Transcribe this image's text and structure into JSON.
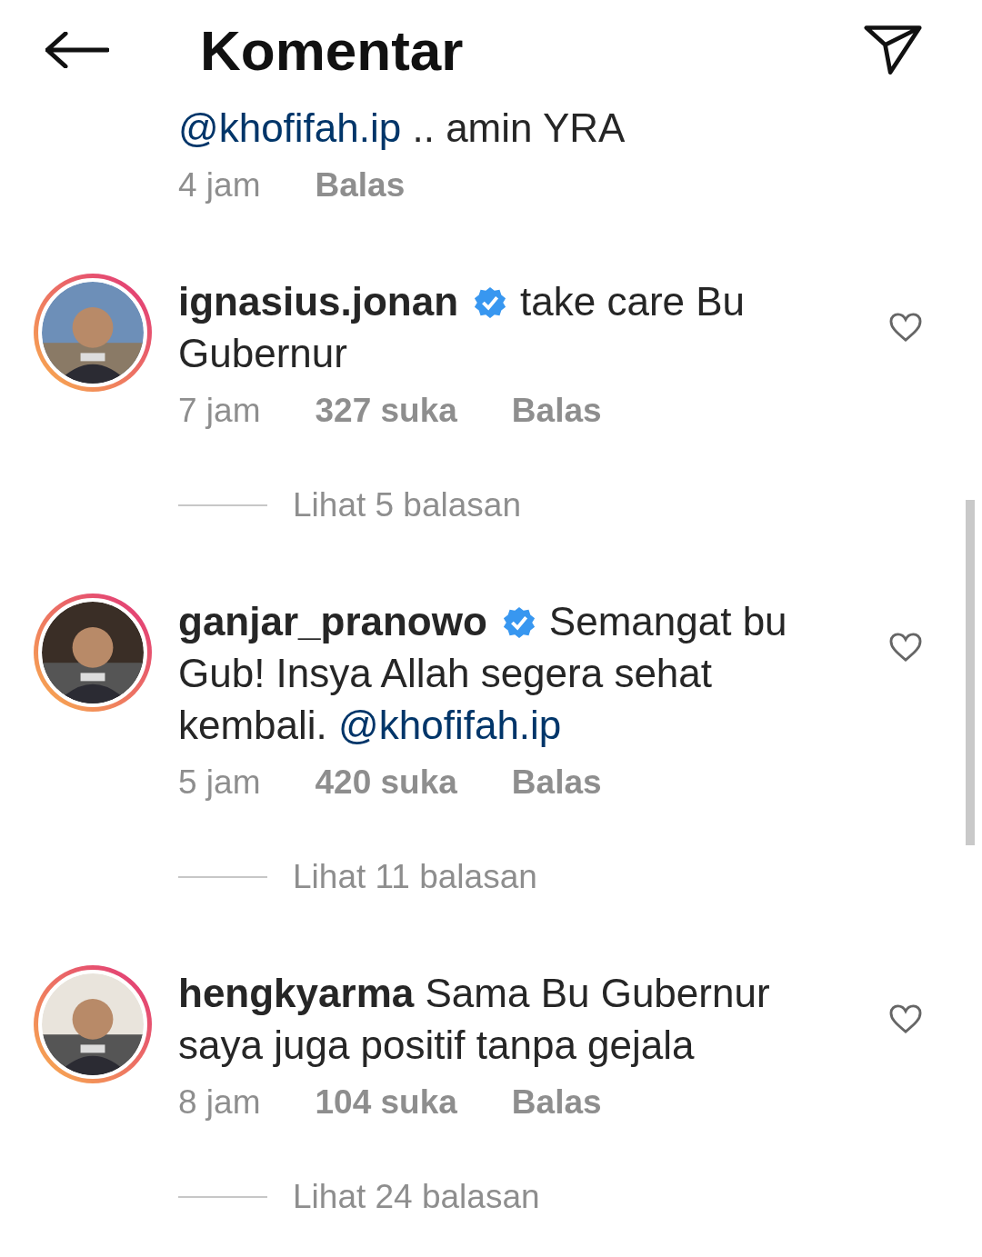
{
  "header": {
    "title": "Komentar"
  },
  "top_comment": {
    "mention": "@khofifah.ip",
    "text": ".. amin YRA",
    "time": "4 jam",
    "reply": "Balas"
  },
  "comments": [
    {
      "username": "ignasius.jonan",
      "verified": true,
      "text": "take care Bu Gubernur",
      "time": "7 jam",
      "likes": "327 suka",
      "reply": "Balas",
      "liked": false,
      "replies": "Lihat 5 balasan"
    },
    {
      "username": "ganjar_pranowo",
      "verified": true,
      "text": "Semangat bu Gub! Insya Allah segera sehat kembali.",
      "mention": "@khofifah.ip",
      "time": "5 jam",
      "likes": "420 suka",
      "reply": "Balas",
      "liked": false,
      "replies": "Lihat 11 balasan"
    },
    {
      "username": "hengkyarma",
      "verified": false,
      "text": "Sama Bu Gubernur saya juga positif tanpa gejala",
      "time": "8 jam",
      "likes": "104 suka",
      "reply": "Balas",
      "liked": false,
      "replies": "Lihat 24 balasan"
    }
  ]
}
